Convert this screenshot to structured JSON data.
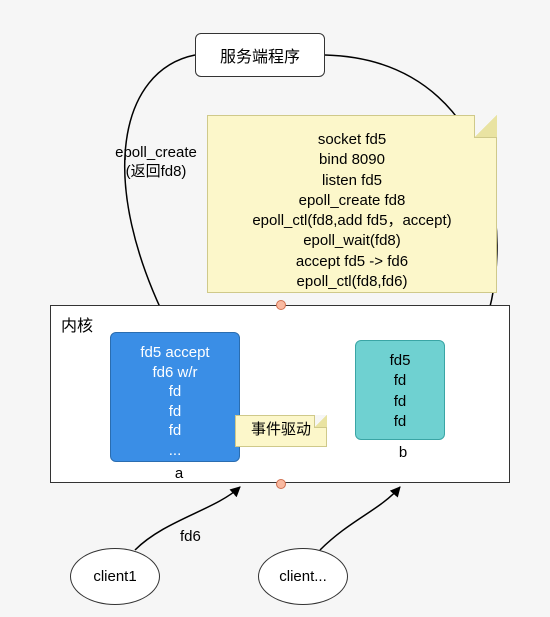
{
  "server": {
    "label": "服务端程序"
  },
  "edges": {
    "epoll_create": "epoll_create",
    "epoll_return": "(返回fd8)",
    "fd6": "fd6"
  },
  "note_lines": [
    "socket fd5",
    "bind 8090",
    "listen fd5",
    "epoll_create fd8",
    "epoll_ctl(fd8,add fd5，accept)",
    "epoll_wait(fd8)",
    "accept fd5  -> fd6",
    "epoll_ctl(fd8,fd6)"
  ],
  "kernel": {
    "title": "内核"
  },
  "box_a": {
    "lines": [
      "fd5 accept",
      "fd6 w/r",
      "fd",
      "fd",
      "fd",
      "..."
    ],
    "caption": "a"
  },
  "box_b": {
    "lines": [
      "fd5",
      "fd",
      "fd",
      "fd"
    ],
    "caption": "b"
  },
  "event_tag": "事件驱动",
  "clients": {
    "c1": "client1",
    "c2": "client..."
  }
}
